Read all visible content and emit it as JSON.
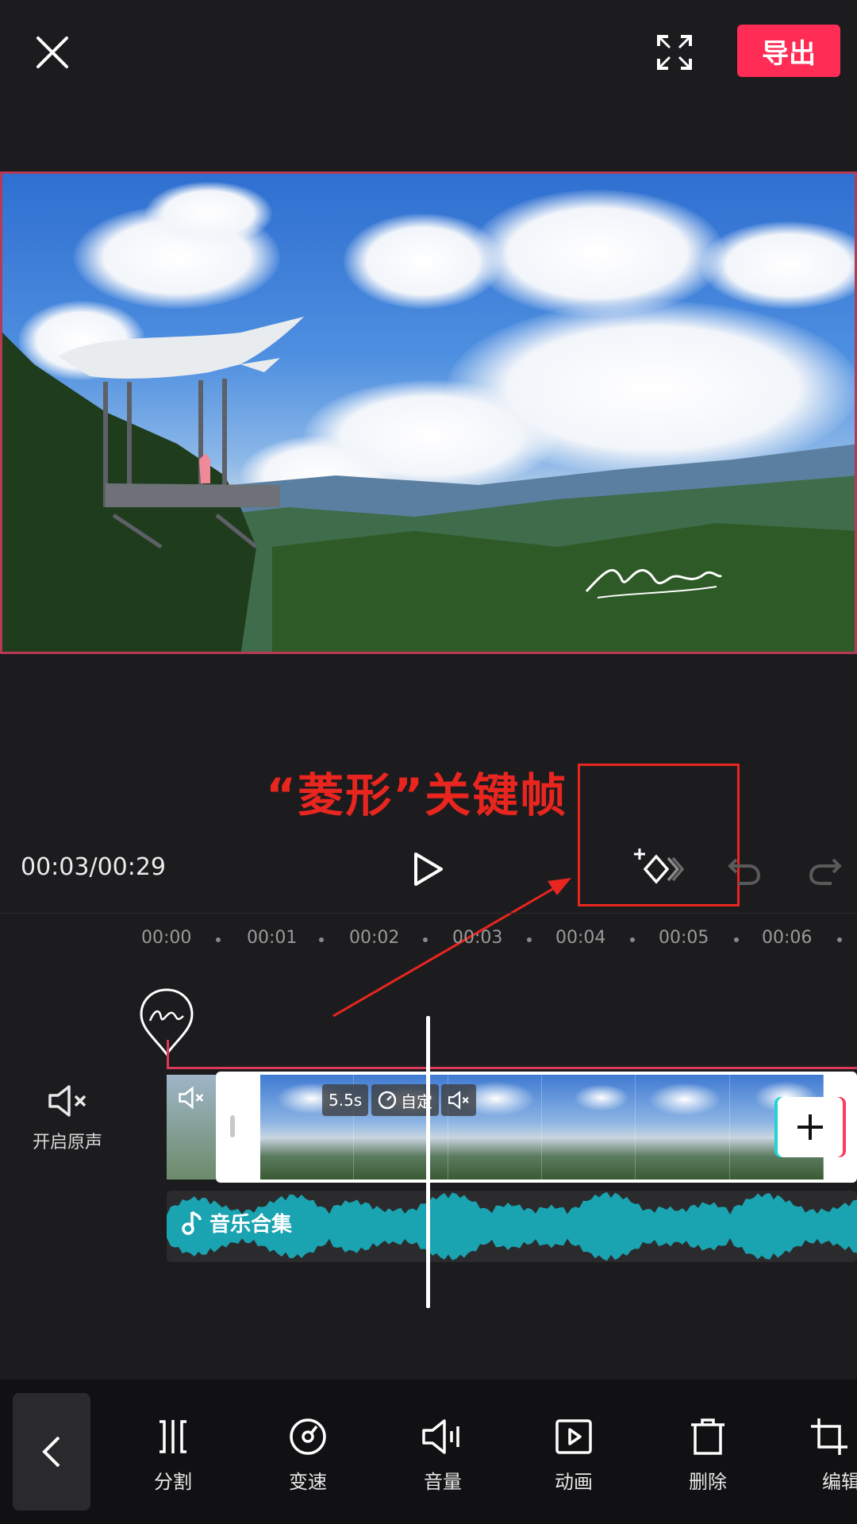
{
  "header": {
    "export_label": "导出"
  },
  "annotation": {
    "text": "“菱形”关键帧"
  },
  "player": {
    "time": "00:03/00:29"
  },
  "ruler": {
    "ticks": [
      "00:00",
      "00:01",
      "00:02",
      "00:03",
      "00:04",
      "00:05",
      "00:06"
    ]
  },
  "audio": {
    "toggle_label": "开启原声"
  },
  "clip": {
    "duration_badge": "5.5s",
    "speed_badge": "自定"
  },
  "music": {
    "label": "音乐合集"
  },
  "toolbar": {
    "items": [
      "分割",
      "变速",
      "音量",
      "动画",
      "删除",
      "编辑"
    ]
  },
  "colors": {
    "accent": "#ff2c55",
    "annotation": "#e8251f",
    "waveform": "#1aa3b0"
  }
}
